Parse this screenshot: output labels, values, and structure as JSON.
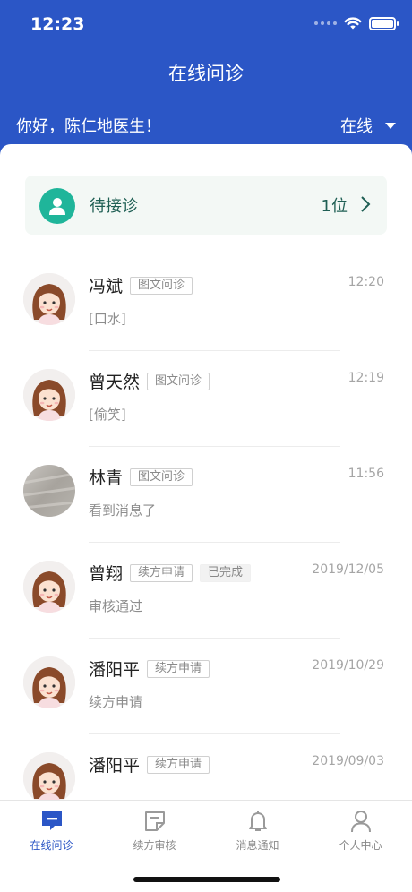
{
  "status_bar": {
    "time": "12:23"
  },
  "header": {
    "title": "在线问诊",
    "greeting": "你好，陈仁地医生！",
    "status_label": "在线",
    "bg_color": "#2b56c6"
  },
  "waiting": {
    "label": "待接诊",
    "count": "1位"
  },
  "conversations": [
    {
      "name": "冯斌",
      "tags": [
        "图文问诊"
      ],
      "time": "12:20",
      "message": "[口水]",
      "avatar": "cartoon-girl"
    },
    {
      "name": "曾天然",
      "tags": [
        "图文问诊"
      ],
      "time": "12:19",
      "message": "[偷笑]",
      "avatar": "cartoon-girl"
    },
    {
      "name": "林青",
      "tags": [
        "图文问诊"
      ],
      "time": "11:56",
      "message": "看到消息了",
      "avatar": "photo"
    },
    {
      "name": "曾翔",
      "tags": [
        "续方申请",
        "已完成"
      ],
      "time": "2019/12/05",
      "message": "审核通过",
      "avatar": "cartoon-girl"
    },
    {
      "name": "潘阳平",
      "tags": [
        "续方申请"
      ],
      "time": "2019/10/29",
      "message": "续方申请",
      "avatar": "cartoon-girl"
    },
    {
      "name": "潘阳平",
      "tags": [
        "续方申请"
      ],
      "time": "2019/09/03",
      "message": "",
      "avatar": "cartoon-girl"
    }
  ],
  "tabbar": [
    {
      "label": "在线问诊",
      "icon": "chat-icon",
      "active": true
    },
    {
      "label": "续方审核",
      "icon": "prescription-icon",
      "active": false
    },
    {
      "label": "消息通知",
      "icon": "bell-icon",
      "active": false
    },
    {
      "label": "个人中心",
      "icon": "person-icon",
      "active": false
    }
  ]
}
